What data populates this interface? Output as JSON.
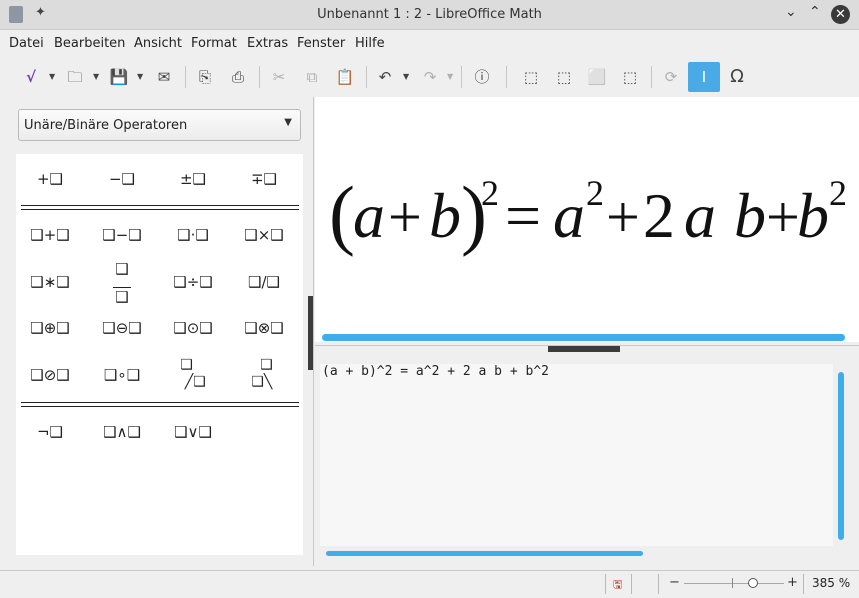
{
  "window": {
    "title": "Unbenannt 1 : 2 - LibreOffice Math",
    "pin_glyph": "✦",
    "minimize_glyph": "⌄",
    "maximize_glyph": "⌃",
    "close_glyph": "✕"
  },
  "menu": [
    "Datei",
    "Bearbeiten",
    "Ansicht",
    "Format",
    "Extras",
    "Fenster",
    "Hilfe"
  ],
  "toolbar": {
    "buttons": [
      {
        "icon": "formula-icon",
        "glyph": "√"
      },
      {
        "icon": "open-folder-icon",
        "glyph": "🗀"
      },
      {
        "icon": "save-icon",
        "glyph": "💾"
      },
      {
        "icon": "email-icon",
        "glyph": "✉"
      },
      {
        "icon": "export-pdf-icon",
        "glyph": "⎘"
      },
      {
        "icon": "print-icon",
        "glyph": "⎙"
      },
      {
        "icon": "cut-icon",
        "glyph": "✂"
      },
      {
        "icon": "copy-icon",
        "glyph": "⧉"
      },
      {
        "icon": "paste-icon",
        "glyph": "📋"
      },
      {
        "icon": "undo-icon",
        "glyph": "↶"
      },
      {
        "icon": "redo-icon",
        "glyph": "↷"
      },
      {
        "icon": "info-icon",
        "glyph": "ⓘ"
      },
      {
        "icon": "zoom-in-icon",
        "glyph": "⬚"
      },
      {
        "icon": "zoom-out-icon",
        "glyph": "⬚"
      },
      {
        "icon": "show-all-icon",
        "glyph": "⬜"
      },
      {
        "icon": "fit-icon",
        "glyph": "⬚"
      },
      {
        "icon": "update-icon",
        "glyph": "⟳"
      },
      {
        "icon": "formula-cursor-icon",
        "glyph": "I"
      },
      {
        "icon": "symbols-icon",
        "glyph": "Ω"
      }
    ],
    "accent_color": "#3daee9"
  },
  "elements_panel": {
    "category": "Unäre/Binäre Operatoren",
    "placeholder_glyph": "❑",
    "rows": [
      [
        "+❑",
        "−❑",
        "±❑",
        "∓❑"
      ],
      [
        "❑+❑",
        "❑−❑",
        "❑·❑",
        "❑×❑"
      ],
      [
        "❑∗❑",
        "fraction",
        "❑÷❑",
        "❑/❑"
      ],
      [
        "❑⊕❑",
        "❑⊖❑",
        "❑⊙❑",
        "❑⊗❑"
      ],
      [
        "❑⊘❑",
        "❑∘❑",
        "wideslash",
        "widebslash"
      ],
      [
        "¬❑",
        "❑∧❑",
        "❑∨❑"
      ]
    ]
  },
  "formula_preview": {
    "lparen": "(",
    "a": "a",
    "plus": "+",
    "b": "b",
    "rparen": ")",
    "exp": "2",
    "eq": "=",
    "two": "2"
  },
  "editor": {
    "text": "(a + b)^2 = a^2 + 2 a b + b^2"
  },
  "statusbar": {
    "minus": "−",
    "plus": "+",
    "zoom": "385 %",
    "zoom_fraction": 0.64
  }
}
